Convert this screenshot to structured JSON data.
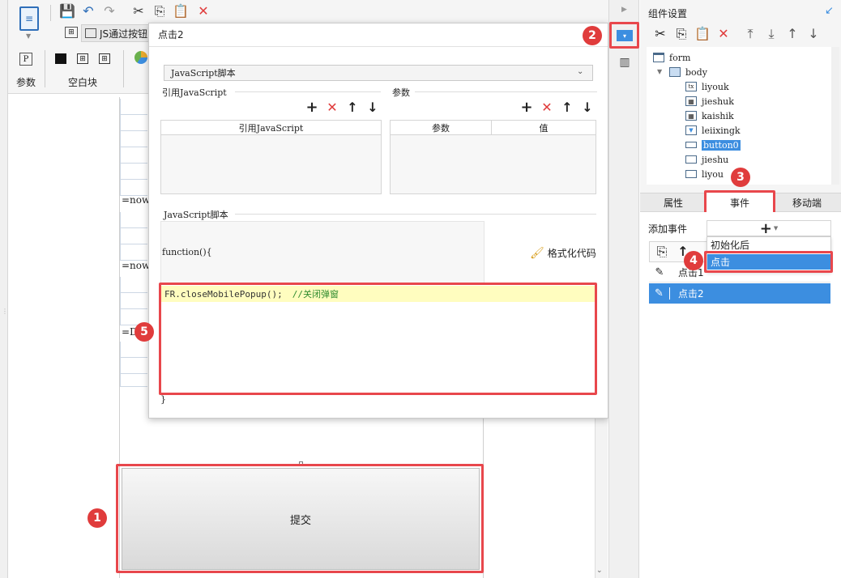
{
  "toolbar": {
    "tab_js_label": "JS通过按钮",
    "param_label": "参数",
    "blank_label": "空白块"
  },
  "dialog": {
    "title": "点击2",
    "select_value": "JavaScript脚本",
    "ref_js_section": "引用JavaScript",
    "params_section": "参数",
    "ref_js_column": "引用JavaScript",
    "param_column": "参数",
    "value_column": "值",
    "script_section": "JavaScript脚本",
    "function_open": "function(){",
    "function_close": "}",
    "format_code_label": "格式化代码",
    "code_statement": "FR.closeMobilePopup();",
    "code_comment": "//关闭弹窗"
  },
  "canvas": {
    "formula_1": "=now",
    "formula_2": "=now",
    "formula_3": "=DA",
    "submit_label": "提交"
  },
  "right_panel": {
    "title": "组件设置",
    "tree": [
      {
        "label": "form"
      },
      {
        "label": "body"
      },
      {
        "label": "liyouk"
      },
      {
        "label": "jieshuk"
      },
      {
        "label": "kaishik"
      },
      {
        "label": "leiixingk"
      },
      {
        "label": "button0"
      },
      {
        "label": "jieshu"
      },
      {
        "label": "liyou"
      }
    ],
    "tabs": [
      {
        "label": "属性"
      },
      {
        "label": "事件"
      },
      {
        "label": "移动端"
      }
    ],
    "add_event_label": "添加事件",
    "dropdown_items": [
      {
        "label": "初始化后"
      },
      {
        "label": "点击"
      }
    ],
    "events": [
      {
        "label": "点击1"
      },
      {
        "label": "点击2"
      }
    ]
  },
  "badges": [
    "1",
    "2",
    "3",
    "4",
    "5"
  ],
  "colors": {
    "accent": "#3c8ee0",
    "highlight_red": "#e8474c",
    "code_bg": "#fffdbf",
    "selection": "#3c8ee0"
  }
}
